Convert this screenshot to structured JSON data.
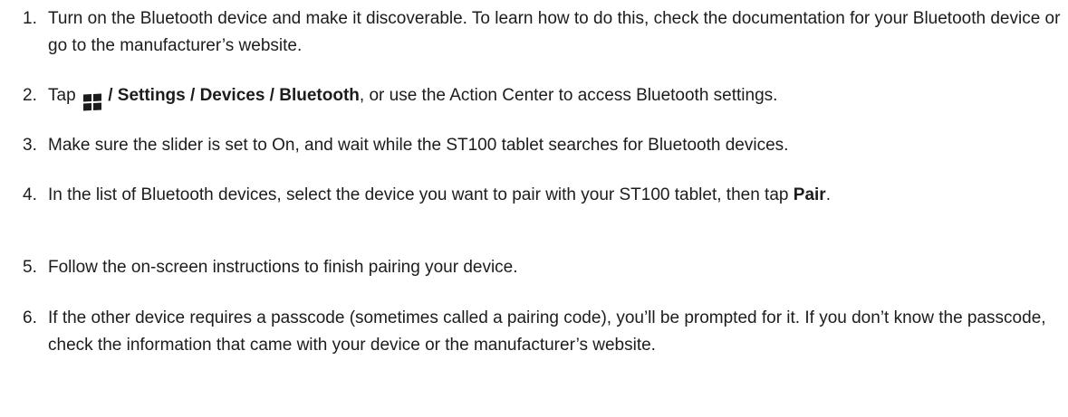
{
  "steps": [
    {
      "number": "1.",
      "text": "Turn on the Bluetooth device and make it discoverable. To learn how to do this, check the documentation for your Bluetooth device or go to the manufacturer’s website."
    },
    {
      "number": "2.",
      "pre": "Tap",
      "icon": "windows-start-icon",
      "path_sep1": " / ",
      "path1": "Settings",
      "path_sep2": " / ",
      "path2": "Devices",
      "path_sep3": " / ",
      "path3": "Bluetooth",
      "post": ", or use the Action Center to access Bluetooth settings."
    },
    {
      "number": "3.",
      "text": "Make sure the slider is set to On, and wait while the ST100 tablet searches for Bluetooth devices."
    },
    {
      "number": "4.",
      "text": "In the list of Bluetooth devices, select the device you want to pair with your ST100 tablet, then tap ",
      "bold": "Pair",
      "post": "."
    },
    {
      "number": "5.",
      "text": "Follow the on-screen instructions to finish pairing your device."
    },
    {
      "number": "6.",
      "text": "If the other device requires a passcode (sometimes called a pairing code), you’ll be prompted for it. If you don’t know the passcode, check the information that came with your device or the manufacturer’s website."
    }
  ]
}
